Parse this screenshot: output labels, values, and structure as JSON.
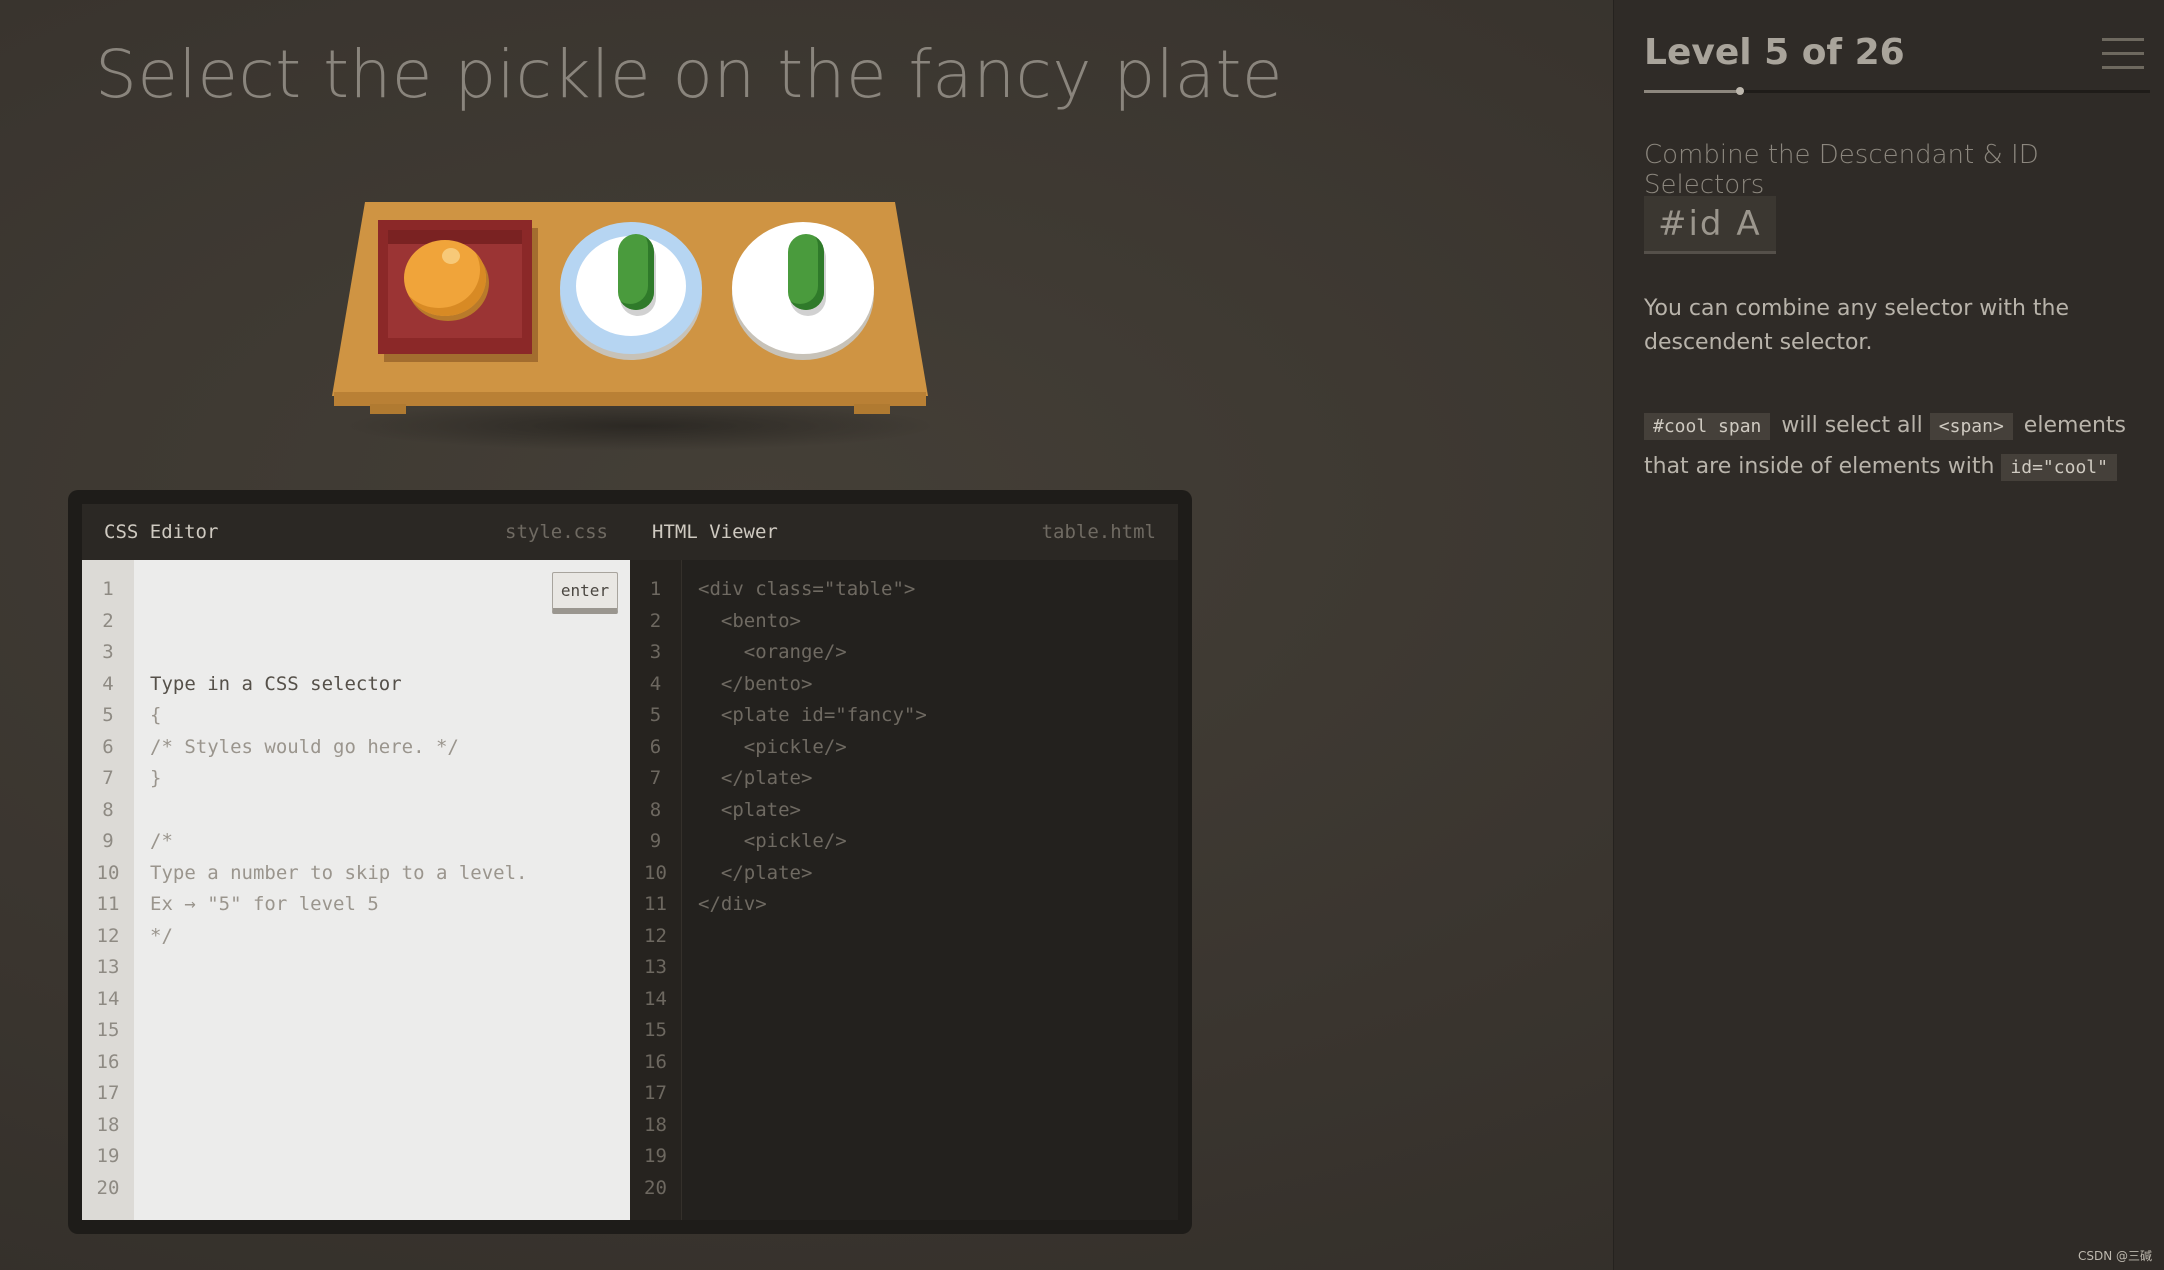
{
  "instruction": "Select the pickle on the fancy plate",
  "editor": {
    "css_title": "CSS Editor",
    "css_file": "style.css",
    "enter_label": "enter",
    "css_lines": [
      "Type in a CSS selector",
      "{",
      "/* Styles would go here. */",
      "}",
      "",
      "/*",
      "Type a number to skip to a level.",
      "Ex → \"5\" for level 5",
      "*/"
    ],
    "html_title": "HTML Viewer",
    "html_file": "table.html",
    "html_lines": [
      "<div class=\"table\">",
      "  <bento>",
      "    <orange/>",
      "  </bento>",
      "  <plate id=\"fancy\">",
      "    <pickle/>",
      "  </plate>",
      "  <plate>",
      "    <pickle/>",
      "  </plate>",
      "</div>"
    ],
    "line_count": 20
  },
  "sidebar": {
    "level_title": "Level 5 of 26",
    "progress": 0.19,
    "selector_name": "Combine the Descendant & ID Selectors",
    "syntax": "#id A",
    "hint": "You can combine any selector with the descendent selector.",
    "example": {
      "code1": "#cool span",
      "text1": "will select all",
      "code2": "<span>",
      "text2": "elements that are inside of elements with",
      "code3": "id=\"cool\""
    }
  },
  "board": {
    "items": [
      "bento",
      "orange",
      "plate-fancy",
      "pickle",
      "plate",
      "pickle"
    ]
  },
  "watermark": "CSDN @三碱"
}
